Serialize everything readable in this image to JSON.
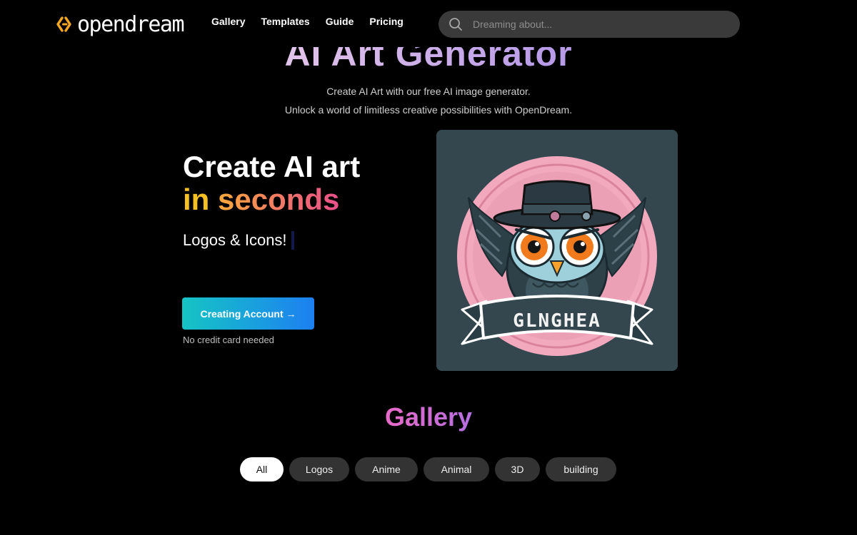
{
  "brand": {
    "name": "opendream",
    "accent": "#f5a623"
  },
  "nav": {
    "links": [
      "Gallery",
      "Templates",
      "Guide",
      "Pricing"
    ],
    "search_placeholder": "Dreaming about..."
  },
  "hero": {
    "title": "AI Art Generator",
    "subtitle_line1": "Create AI Art with our free AI image generator.",
    "subtitle_line2": "Unlock a world of limitless creative possibilities with OpenDream.",
    "headline_line1": "Create AI art",
    "headline_in": "in",
    "headline_seconds": "seconds",
    "typed_text": "Logos & Icons!",
    "cta_label": "Creating Account →",
    "cta_note": "No credit card needed",
    "cta_color": "#1a9ce0",
    "art_banner_text": "GLNGHEA"
  },
  "gallery": {
    "title": "Gallery",
    "chips": [
      {
        "label": "All",
        "active": true
      },
      {
        "label": "Logos",
        "active": false
      },
      {
        "label": "Anime",
        "active": false
      },
      {
        "label": "Animal",
        "active": false
      },
      {
        "label": "3D",
        "active": false
      },
      {
        "label": "building",
        "active": false
      }
    ]
  }
}
